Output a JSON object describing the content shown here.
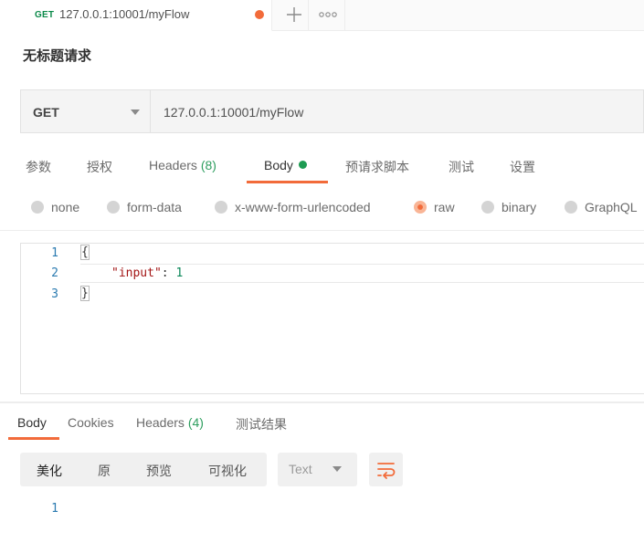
{
  "tab": {
    "method": "GET",
    "url": "127.0.0.1:10001/myFlow"
  },
  "request": {
    "title": "无标题请求",
    "method": "GET",
    "url": "127.0.0.1:10001/myFlow",
    "tabs": [
      {
        "label": "参数"
      },
      {
        "label": "授权"
      },
      {
        "label": "Headers",
        "count": "(8)"
      },
      {
        "label": "Body"
      },
      {
        "label": "预请求脚本"
      },
      {
        "label": "测试"
      },
      {
        "label": "设置"
      }
    ],
    "active_tab": "Body",
    "body_types": [
      "none",
      "form-data",
      "x-www-form-urlencoded",
      "raw",
      "binary",
      "GraphQL"
    ],
    "selected_body_type": "raw",
    "editor": {
      "line_numbers": [
        "1",
        "2",
        "3"
      ],
      "open_brace": "{",
      "key": "\"input\"",
      "colon": ": ",
      "value": "1",
      "close_brace": "}"
    }
  },
  "response": {
    "tabs": [
      {
        "label": "Body"
      },
      {
        "label": "Cookies"
      },
      {
        "label": "Headers",
        "count": "(4)"
      },
      {
        "label": "测试结果"
      }
    ],
    "active_tab": "Body",
    "view_modes": [
      "美化",
      "原",
      "预览",
      "可视化"
    ],
    "active_view_mode": "美化",
    "format": "Text",
    "line_numbers": [
      "1"
    ]
  },
  "colors": {
    "accent": "#f26b3a",
    "success": "#1d9b52",
    "unsaved_dot": "#f26b3a"
  }
}
